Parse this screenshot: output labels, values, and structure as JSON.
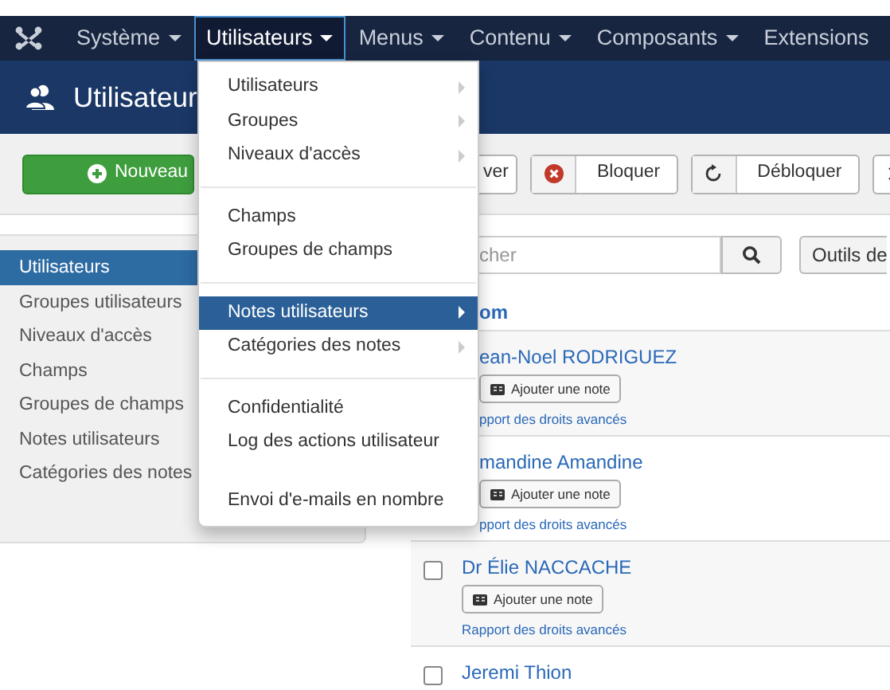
{
  "navbar": {
    "items": [
      {
        "label": "Système",
        "selected": false,
        "caret": true
      },
      {
        "label": "Utilisateurs",
        "selected": true,
        "caret": true
      },
      {
        "label": "Menus",
        "selected": false,
        "caret": true
      },
      {
        "label": "Contenu",
        "selected": false,
        "caret": true
      },
      {
        "label": "Composants",
        "selected": false,
        "caret": true
      },
      {
        "label": "Extensions",
        "selected": false,
        "caret": false
      }
    ]
  },
  "header": {
    "title": "Utilisateur"
  },
  "toolbar": {
    "buttons": [
      {
        "kind": "new",
        "label": "Nouveau"
      },
      {
        "kind": "plain",
        "label": "ver"
      },
      {
        "kind": "block",
        "label": "Bloquer"
      },
      {
        "kind": "unblock",
        "label": "Débloquer"
      },
      {
        "kind": "close"
      }
    ]
  },
  "sidebar": {
    "items": [
      {
        "label": "Utilisateurs",
        "selected": true
      },
      {
        "label": "Groupes utilisateurs",
        "selected": false
      },
      {
        "label": "Niveaux d'accès",
        "selected": false
      },
      {
        "label": "Champs",
        "selected": false
      },
      {
        "label": "Groupes de champs",
        "selected": false
      },
      {
        "label": "Notes utilisateurs",
        "selected": false
      },
      {
        "label": "Catégories des notes",
        "selected": false
      }
    ]
  },
  "search": {
    "placeholder": "cher",
    "tools_label": "Outils de"
  },
  "table": {
    "column": "om",
    "rows": [
      {
        "name": "ean-Noel RODRIGUEZ",
        "note_button": "Ajouter une note",
        "link": "pport des droits avancés"
      },
      {
        "name": "mandine Amandine",
        "note_button": "Ajouter une note",
        "link": "pport des droits avancés"
      },
      {
        "checked": false,
        "name": "Dr Élie NACCACHE",
        "note_button": "Ajouter une note",
        "link": "Rapport des droits avancés"
      },
      {
        "checked": false,
        "name": "Jeremi Thion"
      }
    ]
  },
  "dropdown": {
    "items": [
      {
        "kind": "item",
        "label": "Utilisateurs",
        "submenu": true,
        "selected": false
      },
      {
        "kind": "item",
        "label": "Groupes",
        "submenu": true,
        "selected": false
      },
      {
        "kind": "item",
        "label": "Niveaux d'accès",
        "submenu": true,
        "selected": false
      },
      {
        "kind": "divider"
      },
      {
        "kind": "item",
        "label": "Champs",
        "submenu": false,
        "selected": false
      },
      {
        "kind": "item",
        "label": "Groupes de champs",
        "submenu": false,
        "selected": false
      },
      {
        "kind": "divider"
      },
      {
        "kind": "item",
        "label": "Notes utilisateurs",
        "submenu": true,
        "selected": true
      },
      {
        "kind": "item",
        "label": "Catégories des notes",
        "submenu": true,
        "selected": false
      },
      {
        "kind": "divider"
      },
      {
        "kind": "item",
        "label": "Confidentialité",
        "submenu": false,
        "selected": false
      },
      {
        "kind": "item",
        "label": "Log des actions utilisateur",
        "submenu": false,
        "selected": false
      },
      {
        "kind": "spacer"
      },
      {
        "kind": "item",
        "label": "Envoi d'e-mails en nombre",
        "submenu": false,
        "selected": false
      }
    ]
  }
}
